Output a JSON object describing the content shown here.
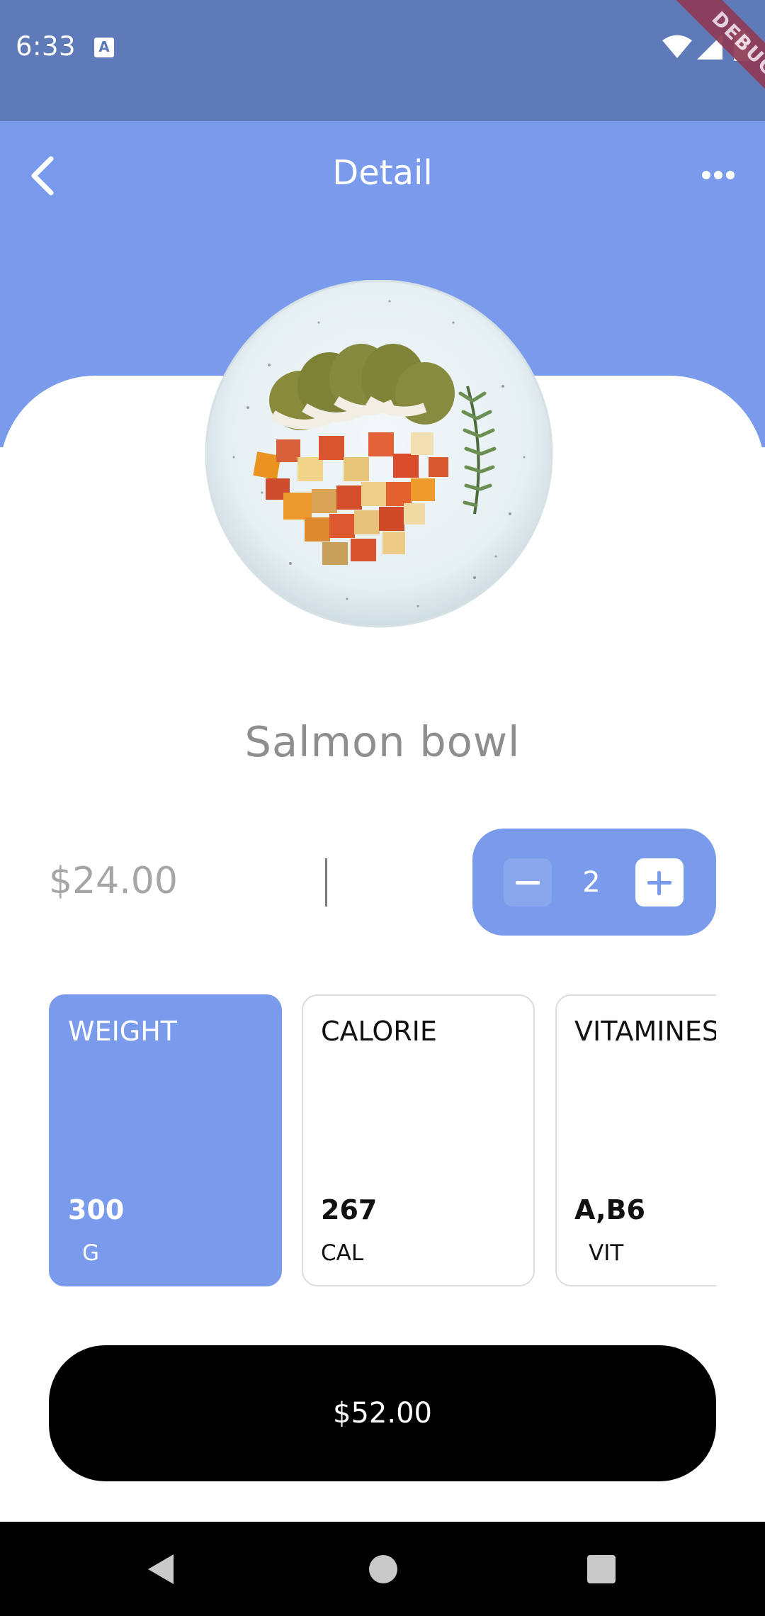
{
  "status_bar": {
    "time": "6:33",
    "notification_icon": "a-letter-icon",
    "notification_letter": "A",
    "icons": [
      "wifi-icon",
      "signal-icon",
      "battery-icon"
    ],
    "debug_banner": "DEBUG"
  },
  "header": {
    "title": "Detail",
    "back_icon": "chevron-left-icon",
    "menu_icon": "more-horizontal-icon"
  },
  "product": {
    "name": "Salmon bowl",
    "price": "$24.00",
    "quantity": "2",
    "image_icon": "food-plate-image"
  },
  "info_cards": [
    {
      "title": "WEIGHT",
      "value": "300",
      "unit": "G",
      "active": true
    },
    {
      "title": "CALORIE",
      "value": "267",
      "unit": "CAL",
      "active": false
    },
    {
      "title": "VITAMINES",
      "value": "A,B6",
      "unit": "VIT",
      "active": false
    }
  ],
  "total_button": {
    "label": "$52.00"
  },
  "nav_bar": {
    "icons": [
      "nav-back-icon",
      "nav-home-icon",
      "nav-recents-icon"
    ]
  },
  "colors": {
    "accent": "#7a9aec",
    "status_bar": "#5f7ab9",
    "button": "#000000"
  }
}
